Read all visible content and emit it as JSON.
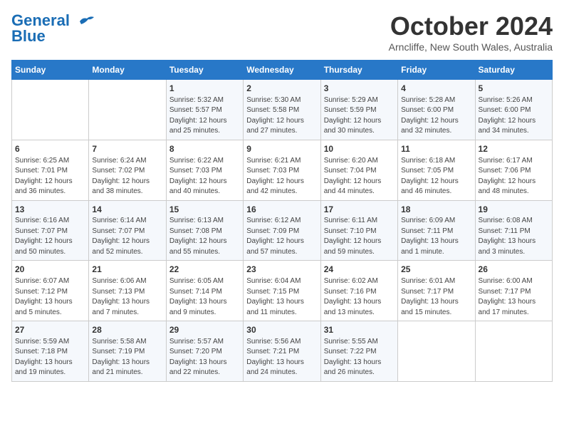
{
  "logo": {
    "line1": "General",
    "line2": "Blue"
  },
  "title": "October 2024",
  "subtitle": "Arncliffe, New South Wales, Australia",
  "days_of_week": [
    "Sunday",
    "Monday",
    "Tuesday",
    "Wednesday",
    "Thursday",
    "Friday",
    "Saturday"
  ],
  "weeks": [
    [
      {
        "day": "",
        "info": ""
      },
      {
        "day": "",
        "info": ""
      },
      {
        "day": "1",
        "info": "Sunrise: 5:32 AM\nSunset: 5:57 PM\nDaylight: 12 hours\nand 25 minutes."
      },
      {
        "day": "2",
        "info": "Sunrise: 5:30 AM\nSunset: 5:58 PM\nDaylight: 12 hours\nand 27 minutes."
      },
      {
        "day": "3",
        "info": "Sunrise: 5:29 AM\nSunset: 5:59 PM\nDaylight: 12 hours\nand 30 minutes."
      },
      {
        "day": "4",
        "info": "Sunrise: 5:28 AM\nSunset: 6:00 PM\nDaylight: 12 hours\nand 32 minutes."
      },
      {
        "day": "5",
        "info": "Sunrise: 5:26 AM\nSunset: 6:00 PM\nDaylight: 12 hours\nand 34 minutes."
      }
    ],
    [
      {
        "day": "6",
        "info": "Sunrise: 6:25 AM\nSunset: 7:01 PM\nDaylight: 12 hours\nand 36 minutes."
      },
      {
        "day": "7",
        "info": "Sunrise: 6:24 AM\nSunset: 7:02 PM\nDaylight: 12 hours\nand 38 minutes."
      },
      {
        "day": "8",
        "info": "Sunrise: 6:22 AM\nSunset: 7:03 PM\nDaylight: 12 hours\nand 40 minutes."
      },
      {
        "day": "9",
        "info": "Sunrise: 6:21 AM\nSunset: 7:03 PM\nDaylight: 12 hours\nand 42 minutes."
      },
      {
        "day": "10",
        "info": "Sunrise: 6:20 AM\nSunset: 7:04 PM\nDaylight: 12 hours\nand 44 minutes."
      },
      {
        "day": "11",
        "info": "Sunrise: 6:18 AM\nSunset: 7:05 PM\nDaylight: 12 hours\nand 46 minutes."
      },
      {
        "day": "12",
        "info": "Sunrise: 6:17 AM\nSunset: 7:06 PM\nDaylight: 12 hours\nand 48 minutes."
      }
    ],
    [
      {
        "day": "13",
        "info": "Sunrise: 6:16 AM\nSunset: 7:07 PM\nDaylight: 12 hours\nand 50 minutes."
      },
      {
        "day": "14",
        "info": "Sunrise: 6:14 AM\nSunset: 7:07 PM\nDaylight: 12 hours\nand 52 minutes."
      },
      {
        "day": "15",
        "info": "Sunrise: 6:13 AM\nSunset: 7:08 PM\nDaylight: 12 hours\nand 55 minutes."
      },
      {
        "day": "16",
        "info": "Sunrise: 6:12 AM\nSunset: 7:09 PM\nDaylight: 12 hours\nand 57 minutes."
      },
      {
        "day": "17",
        "info": "Sunrise: 6:11 AM\nSunset: 7:10 PM\nDaylight: 12 hours\nand 59 minutes."
      },
      {
        "day": "18",
        "info": "Sunrise: 6:09 AM\nSunset: 7:11 PM\nDaylight: 13 hours\nand 1 minute."
      },
      {
        "day": "19",
        "info": "Sunrise: 6:08 AM\nSunset: 7:11 PM\nDaylight: 13 hours\nand 3 minutes."
      }
    ],
    [
      {
        "day": "20",
        "info": "Sunrise: 6:07 AM\nSunset: 7:12 PM\nDaylight: 13 hours\nand 5 minutes."
      },
      {
        "day": "21",
        "info": "Sunrise: 6:06 AM\nSunset: 7:13 PM\nDaylight: 13 hours\nand 7 minutes."
      },
      {
        "day": "22",
        "info": "Sunrise: 6:05 AM\nSunset: 7:14 PM\nDaylight: 13 hours\nand 9 minutes."
      },
      {
        "day": "23",
        "info": "Sunrise: 6:04 AM\nSunset: 7:15 PM\nDaylight: 13 hours\nand 11 minutes."
      },
      {
        "day": "24",
        "info": "Sunrise: 6:02 AM\nSunset: 7:16 PM\nDaylight: 13 hours\nand 13 minutes."
      },
      {
        "day": "25",
        "info": "Sunrise: 6:01 AM\nSunset: 7:17 PM\nDaylight: 13 hours\nand 15 minutes."
      },
      {
        "day": "26",
        "info": "Sunrise: 6:00 AM\nSunset: 7:17 PM\nDaylight: 13 hours\nand 17 minutes."
      }
    ],
    [
      {
        "day": "27",
        "info": "Sunrise: 5:59 AM\nSunset: 7:18 PM\nDaylight: 13 hours\nand 19 minutes."
      },
      {
        "day": "28",
        "info": "Sunrise: 5:58 AM\nSunset: 7:19 PM\nDaylight: 13 hours\nand 21 minutes."
      },
      {
        "day": "29",
        "info": "Sunrise: 5:57 AM\nSunset: 7:20 PM\nDaylight: 13 hours\nand 22 minutes."
      },
      {
        "day": "30",
        "info": "Sunrise: 5:56 AM\nSunset: 7:21 PM\nDaylight: 13 hours\nand 24 minutes."
      },
      {
        "day": "31",
        "info": "Sunrise: 5:55 AM\nSunset: 7:22 PM\nDaylight: 13 hours\nand 26 minutes."
      },
      {
        "day": "",
        "info": ""
      },
      {
        "day": "",
        "info": ""
      }
    ]
  ]
}
